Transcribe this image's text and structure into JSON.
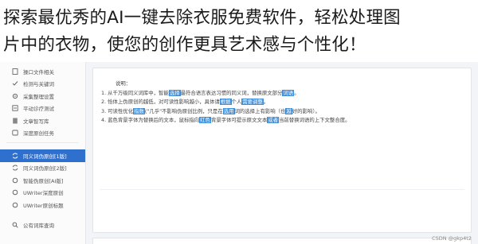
{
  "banner": {
    "line1": "探索最优秀的AI一键去除衣服免费软件，轻松处理图",
    "line2": "片中的衣物，使您的创作更具艺术感与个性化！"
  },
  "sidebar": {
    "items": [
      {
        "label": "操口文件相关",
        "icon": "file-icon"
      },
      {
        "label": "检测与关键词",
        "icon": "check-icon"
      },
      {
        "label": "采集整理设置",
        "icon": "gear-icon"
      },
      {
        "label": "平动诊疗测试",
        "icon": "test-icon"
      },
      {
        "label": "文章智写库",
        "icon": "doc-icon"
      },
      {
        "label": "深度原创任务",
        "icon": "task-icon"
      },
      {
        "label": "同义词伪原创[1版]",
        "icon": "sync-icon"
      },
      {
        "label": "同义词伪原创[2版]",
        "icon": "sync-icon"
      },
      {
        "label": "智能伪原创[AI版]",
        "icon": "refresh-icon"
      },
      {
        "label": "UWriter深度原创",
        "icon": "refresh-icon"
      },
      {
        "label": "UWriter原创标题",
        "icon": "refresh-icon"
      },
      {
        "label": "公有词库查询",
        "icon": "search-icon"
      }
    ],
    "active_index": 6
  },
  "notes": {
    "title": "说明：",
    "l1_a": "1. 从千万级同义词库中，智能",
    "l1_h1": "选择",
    "l1_b": "最符合语言表达习惯的同义词，替换原文部分",
    "l1_h2": "词语",
    "l1_c": "。",
    "l2_a": "2. 恰体上伪原创的越低，对可读性影响越小，具体请",
    "l2_h1": "根据",
    "l2_b": "个人",
    "l2_h2": "需要调整",
    "l2_c": "。",
    "l3_a": "3. 可读性优化",
    "l3_h1": "指数",
    "l3_b": "(\"几乎\"不影响伪原创比例，只是在",
    "l3_h2": "选用",
    "l3_c": "词的选择上有影响（也",
    "l3_h3": "越",
    "l3_d": "好的影响）。",
    "l4_a": "4. 蓝色背景字体为替换后的文本，鼠标指向",
    "l4_h1": "红色",
    "l4_b": "背景字体可提示原文文本",
    "l4_h2": "或者",
    "l4_c": "当前替换词语的上下文整合度。"
  },
  "watermark": "CSDN @gkp4t2",
  "colors": {
    "accent": "#2f6fce",
    "highlight": "#3f8ed8"
  }
}
